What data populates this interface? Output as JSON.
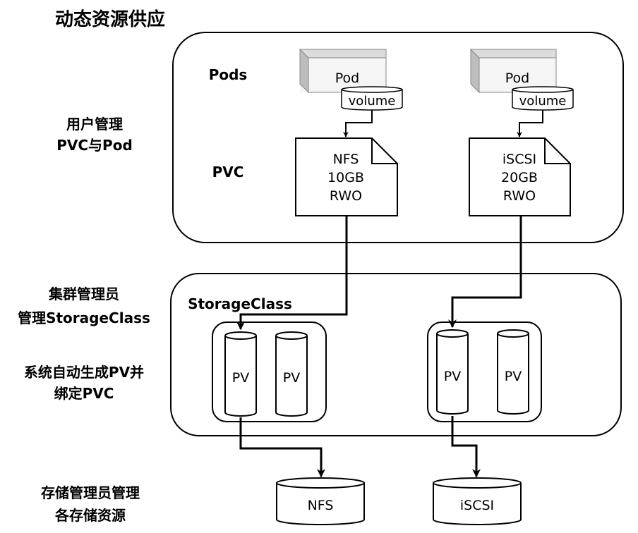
{
  "title": "动态资源供应",
  "left_labels": {
    "user_line1": "用户管理",
    "user_line2": "PVC与Pod",
    "admin_line1": "集群管理员",
    "admin_line2": "管理StorageClass",
    "system_line1": "系统自动生成PV并",
    "system_line2": "绑定PVC",
    "storage_line1": "存储管理员管理",
    "storage_line2": "各存储资源"
  },
  "user_box": {
    "pods_label": "Pods",
    "pvc_label": "PVC",
    "pods": [
      {
        "label": "Pod",
        "volume": "volume"
      },
      {
        "label": "Pod",
        "volume": "volume"
      }
    ],
    "pvcs": [
      {
        "line1": "NFS",
        "line2": "10GB",
        "line3": "RWO"
      },
      {
        "line1": "iSCSI",
        "line2": "20GB",
        "line3": "RWO"
      }
    ]
  },
  "storageclass_box": {
    "label": "StorageClass",
    "groups": [
      {
        "pvs": [
          "PV",
          "PV"
        ]
      },
      {
        "pvs": [
          "PV",
          "PV"
        ]
      }
    ]
  },
  "backends": [
    "NFS",
    "iSCSI"
  ]
}
